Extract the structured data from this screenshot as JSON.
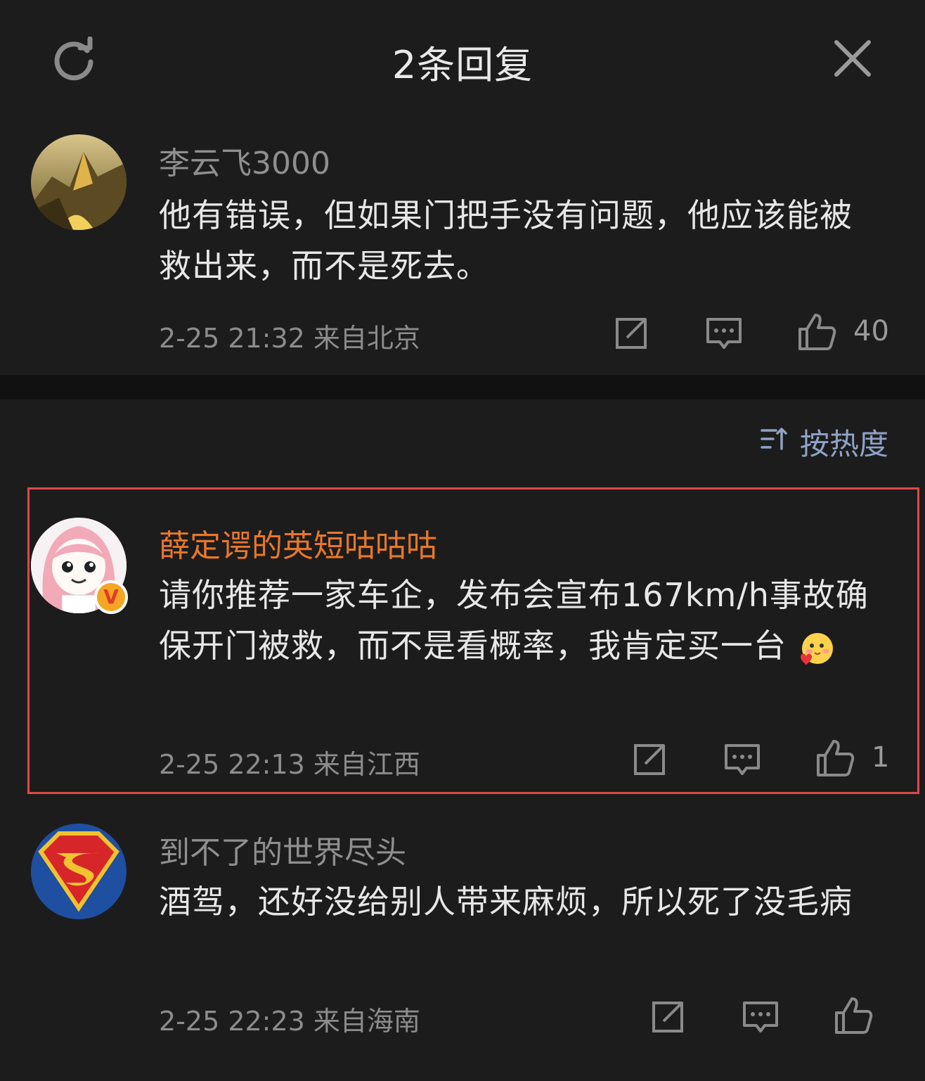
{
  "header": {
    "title": "2条回复",
    "refresh_icon": "refresh-icon",
    "close_icon": "close-icon"
  },
  "sort": {
    "label": "按热度",
    "icon": "sort-icon"
  },
  "comments": [
    {
      "username": "李云飞3000",
      "text": "他有错误，但如果门把手没有问题，他应该能被救出来，而不是死去。",
      "meta": "2-25 21:32 来自北京",
      "likes": "40"
    },
    {
      "username": "薛定谔的英短咕咕咕",
      "text": "请你推荐一家车企，发布会宣布167km/h事故确保开门被救，而不是看概率，我肯定买一台",
      "emoji": "shy-blush-emoji",
      "badge": "V",
      "meta": "2-25 22:13 来自江西",
      "likes": "1"
    },
    {
      "username": "到不了的世界尽头",
      "text": "酒驾，还好没给别人带来麻烦，所以死了没毛病",
      "meta": "2-25 22:23 来自海南",
      "likes": ""
    }
  ],
  "colors": {
    "background": "#1c1c1c",
    "vip_name": "#e8772b",
    "sort_label": "#8fa3c7",
    "highlight_border": "#e04848"
  }
}
